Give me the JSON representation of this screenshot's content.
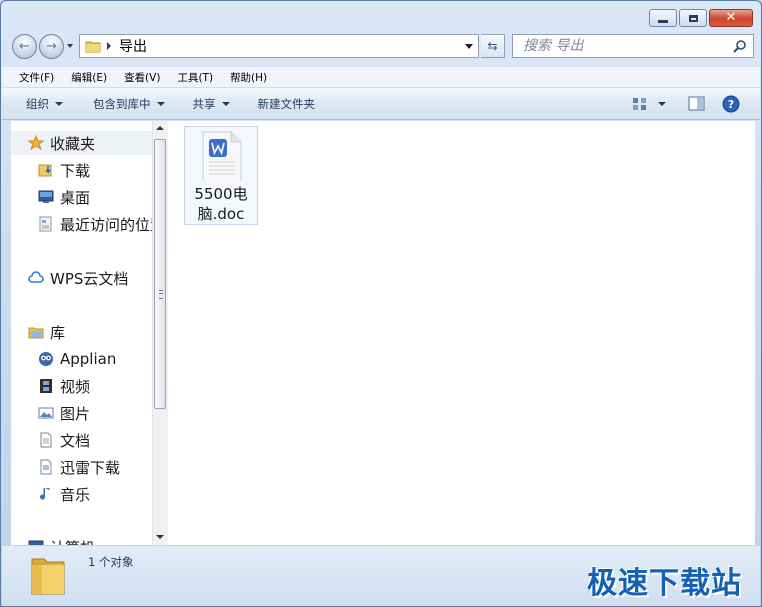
{
  "address": {
    "folder": "导出"
  },
  "search": {
    "placeholder": "搜索 导出"
  },
  "menubar": [
    {
      "label": "文件(F)"
    },
    {
      "label": "编辑(E)"
    },
    {
      "label": "查看(V)"
    },
    {
      "label": "工具(T)"
    },
    {
      "label": "帮助(H)"
    }
  ],
  "toolbar": {
    "organize": "组织",
    "include_in_library": "包含到库中",
    "share": "共享",
    "new_folder": "新建文件夹"
  },
  "navpane": {
    "favorites": {
      "label": "收藏夹",
      "items": [
        "下载",
        "桌面",
        "最近访问的位置"
      ]
    },
    "wps_cloud": "WPS云文档",
    "libraries": {
      "label": "库",
      "items": [
        "Applian",
        "视频",
        "图片",
        "文档",
        "迅雷下载",
        "音乐"
      ]
    },
    "computer": "计算机"
  },
  "files": [
    {
      "name": "5500电脑.doc",
      "icon": "wps-word-doc-icon"
    }
  ],
  "statusbar": {
    "count_text": "1 个对象",
    "watermark": "极速下载站"
  },
  "colors": {
    "accent": "#1e395b",
    "watermark": "#1460b4",
    "wps_blue": "#3d6fc6"
  }
}
